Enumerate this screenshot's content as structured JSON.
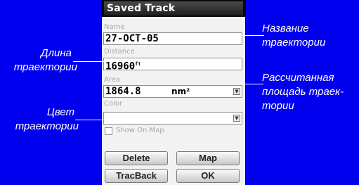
{
  "window": {
    "title": "Saved Track"
  },
  "fields": {
    "name": {
      "label": "Name",
      "value": "27-OCT-05"
    },
    "distance": {
      "label": "Distance",
      "value": "16960",
      "unit": "ft"
    },
    "area": {
      "label": "Area",
      "value": "1864.8",
      "unit": "nm²"
    },
    "color": {
      "label": "Color",
      "value": ""
    }
  },
  "show_on_map": {
    "label": "Show On Map",
    "checked": false
  },
  "buttons": {
    "delete": "Delete",
    "map": "Map",
    "trackback": "TracBack",
    "ok": "OK"
  },
  "annotations": {
    "track_length": [
      "Длина",
      "траектории"
    ],
    "track_color": [
      "Цвет",
      "траектории"
    ],
    "track_name": [
      "Название",
      "траектории"
    ],
    "computed_area": [
      "Рассчитанная",
      "площадь трaек-",
      "тории"
    ]
  },
  "colors": {
    "background": "#0000ee",
    "annotation_text": "#ffffff"
  }
}
